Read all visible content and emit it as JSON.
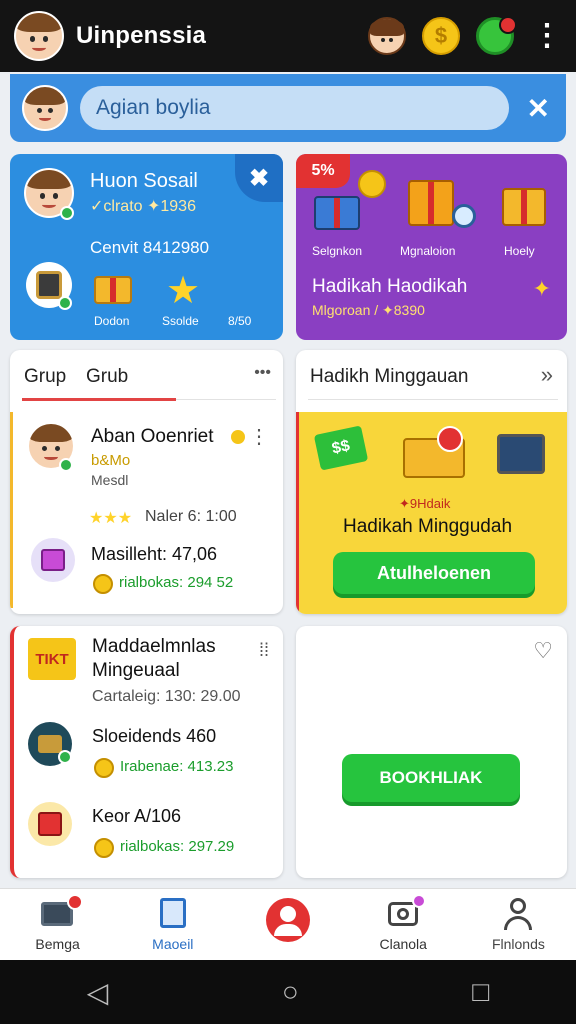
{
  "header": {
    "title": "Uinpenssia",
    "icons": [
      "avatar-icon",
      "profile-girl-icon",
      "coin-icon",
      "green-orb-icon",
      "more-vert-icon"
    ],
    "coin_symbol": "$"
  },
  "search": {
    "placeholder": "Agian boylia",
    "close_symbol": "✕"
  },
  "profile_card": {
    "name": "Huon Sosail",
    "sub": "✓clrato ✦1936",
    "count": "Cenvit 8412980",
    "reward1_label": "Dodon",
    "reward2_label": "Ssolde",
    "reward3_label": "8/50",
    "pin_symbol": "✖"
  },
  "gift_card": {
    "badge": "5%",
    "item1": "Selgnkon",
    "item2": "Mgnaloion",
    "item3": "Hoely",
    "title": "Hadikah Haodikah",
    "sub": "Mlgoroan / ✦8390"
  },
  "group_panel": {
    "tab1": "Grup",
    "tab2": "Grub",
    "more": "•••",
    "user_name": "Aban Ooenriet",
    "user_tag": "b&Mo",
    "user_sub": "Mesdl",
    "rating_stars": "★★★",
    "rating_text": "Naler 6: 1:00",
    "item_title": "Masilleht: 47,06",
    "item_value": "rialbokas: 294 52"
  },
  "weekly_panel": {
    "title": "Hadikh Minggauan",
    "promo_small": "✦9Hdaik",
    "promo_title": "Hadikah Minggudah",
    "button": "Atulheloenen"
  },
  "list_panel": {
    "title_line1": "Maddaelmnlas",
    "title_line2": "Mingeuaal",
    "sub": "Cartaleig: 130: 29.00",
    "row1_title": "Sloeidends 460",
    "row1_value": "Irabenae: 413.23",
    "row2_title": "Keor A/106",
    "row2_value": "rialbokas: 297.29"
  },
  "empty_panel": {
    "button": "BOOKHLIAK"
  },
  "bottom_nav": [
    {
      "label": "Bemga",
      "icon": "tv-icon"
    },
    {
      "label": "Maoeil",
      "icon": "document-icon"
    },
    {
      "label": "",
      "icon": "profile-icon"
    },
    {
      "label": "Clanola",
      "icon": "camera-icon"
    },
    {
      "label": "Flnlonds",
      "icon": "person-icon"
    }
  ],
  "colors": {
    "accent_blue": "#2c8ee0",
    "purple": "#8a3fc2",
    "green": "#26c43e",
    "yellow": "#f8d63a",
    "red": "#e23232"
  }
}
